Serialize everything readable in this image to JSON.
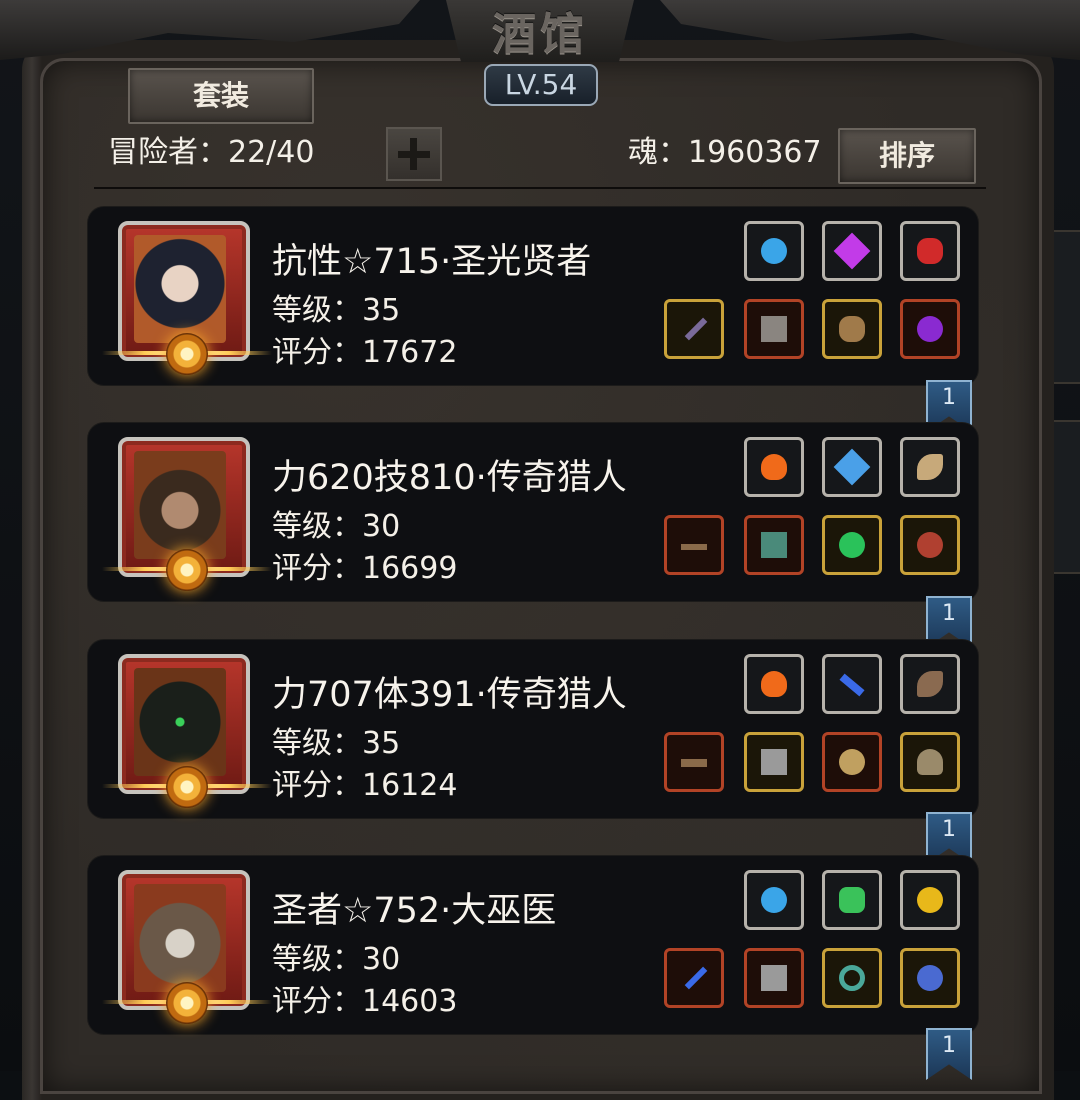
{
  "header": {
    "title": "酒馆",
    "level": "LV.54",
    "set_button": "套装",
    "adventurers": "冒险者：22/40",
    "soul": "魂：1960367",
    "sort_button": "排序"
  },
  "heroes": [
    {
      "name": "抗性☆715·圣光贤者",
      "level": "等级：35",
      "score": "评分：17672",
      "bookmark": "1",
      "equipment_top": [
        {
          "icon": "blue-orb-icon",
          "color": "#3aa5e8"
        },
        {
          "icon": "purple-crystal-icon",
          "color": "#c23be8"
        },
        {
          "icon": "red-gem-icon",
          "color": "#d12a2a"
        }
      ],
      "equipment_bottom": [
        {
          "icon": "mace-icon",
          "color": "#7a6a9a"
        },
        {
          "icon": "robe-icon",
          "color": "#8a8580"
        },
        {
          "icon": "mask-icon",
          "color": "#a07a4a"
        },
        {
          "icon": "pendant-icon",
          "color": "#8a2ad1"
        }
      ]
    },
    {
      "name": "力620技810·传奇猎人",
      "level": "等级：30",
      "score": "评分：16699",
      "bookmark": "1",
      "equipment_top": [
        {
          "icon": "fire-icon",
          "color": "#f06a1a"
        },
        {
          "icon": "blue-pendant-icon",
          "color": "#4aa0e8"
        },
        {
          "icon": "horn-icon",
          "color": "#c7a97a"
        }
      ],
      "equipment_bottom": [
        {
          "icon": "musket-icon",
          "color": "#8a6a4a"
        },
        {
          "icon": "armor-icon",
          "color": "#4a8a7a"
        },
        {
          "icon": "green-charm-icon",
          "color": "#2ac25a"
        },
        {
          "icon": "skull-icon",
          "color": "#b04030"
        }
      ]
    },
    {
      "name": "力707体391·传奇猎人",
      "level": "等级：35",
      "score": "评分：16124",
      "bookmark": "1",
      "equipment_top": [
        {
          "icon": "fire-icon",
          "color": "#f06a1a"
        },
        {
          "icon": "blue-feather-icon",
          "color": "#3a6ae8"
        },
        {
          "icon": "horn-icon",
          "color": "#8a6a50"
        }
      ],
      "equipment_bottom": [
        {
          "icon": "pistol-icon",
          "color": "#8a6a4a"
        },
        {
          "icon": "armor-icon",
          "color": "#9a9a9a"
        },
        {
          "icon": "medal-icon",
          "color": "#c0a060"
        },
        {
          "icon": "helmet-icon",
          "color": "#9a8a6a"
        }
      ]
    },
    {
      "name": "圣者☆752·大巫医",
      "level": "等级：30",
      "score": "评分：14603",
      "bookmark": "1",
      "equipment_top": [
        {
          "icon": "blue-orb-icon",
          "color": "#3aa5e8"
        },
        {
          "icon": "lantern-icon",
          "color": "#3ac25a"
        },
        {
          "icon": "golden-apple-icon",
          "color": "#e8b81a"
        }
      ],
      "equipment_bottom": [
        {
          "icon": "staff-icon",
          "color": "#3a6ae8"
        },
        {
          "icon": "armor-icon",
          "color": "#9a9a9a"
        },
        {
          "icon": "ring-icon",
          "color": "#4aa89a"
        },
        {
          "icon": "pendant-icon",
          "color": "#4a6ad1"
        }
      ]
    }
  ]
}
